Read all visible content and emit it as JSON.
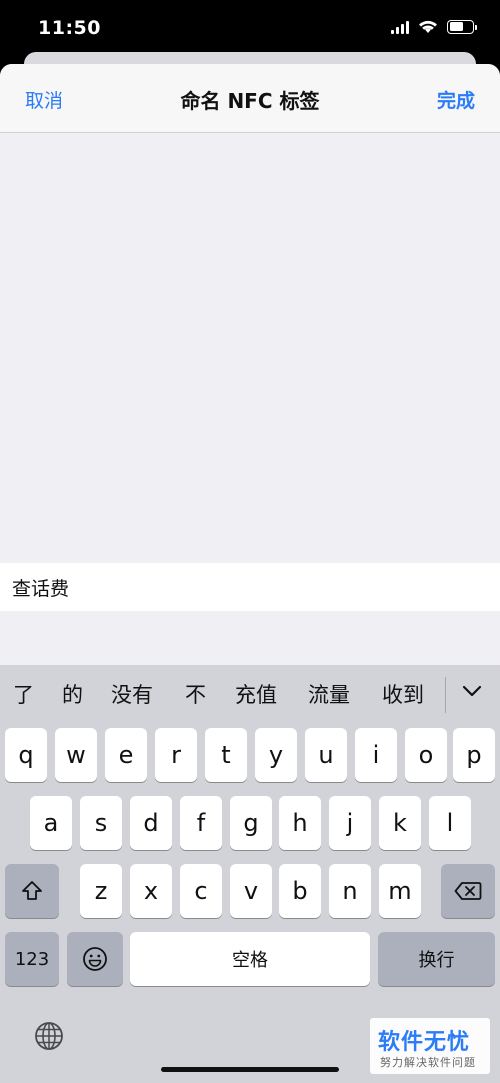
{
  "status_bar": {
    "time": "11:50"
  },
  "nav": {
    "cancel_label": "取消",
    "title": "命名 NFC 标签",
    "done_label": "完成"
  },
  "input": {
    "value": "查话费"
  },
  "keyboard": {
    "candidates": [
      "了",
      "的",
      "没有",
      "不",
      "充值",
      "流量",
      "收到"
    ],
    "row1": [
      "q",
      "w",
      "e",
      "r",
      "t",
      "y",
      "u",
      "i",
      "o",
      "p"
    ],
    "row2": [
      "a",
      "s",
      "d",
      "f",
      "g",
      "h",
      "j",
      "k",
      "l"
    ],
    "row3": [
      "z",
      "x",
      "c",
      "v",
      "b",
      "n",
      "m"
    ],
    "numbers_label": "123",
    "space_label": "空格",
    "return_label": "换行"
  },
  "watermark": {
    "main": "软件无忧",
    "sub": "努力解决软件问题"
  },
  "colors": {
    "accent": "#2b7cf6",
    "keyboard_bg": "#d1d3d9"
  }
}
